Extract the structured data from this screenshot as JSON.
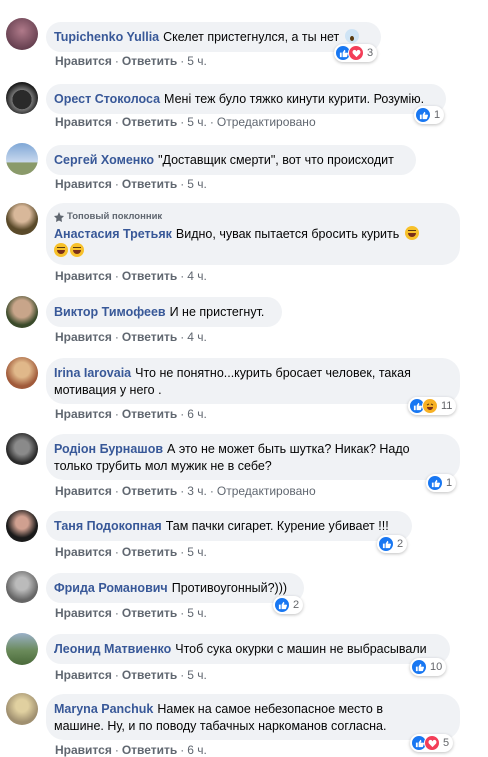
{
  "colors": {
    "author": "#385898",
    "bubble": "#f0f2f5",
    "like": "#1877f2",
    "love": "#f33e58",
    "haha": "#f7b125"
  },
  "labels": {
    "like": "Нравится",
    "reply": "Ответить",
    "edited": "Отредактировано",
    "top_fan": "Топовый поклонник"
  },
  "comments": [
    {
      "author": "Tupichenko Yullia",
      "text": "Скелет пристегнулся, а ты нет",
      "time": "5 ч.",
      "reactions": [
        "like",
        "love"
      ],
      "reaction_count": "3",
      "emoji": "scream"
    },
    {
      "author": "Орест Стоколоса",
      "text": "Мені теж було тяжко кинути курити. Розумію.",
      "time": "5 ч.",
      "edited": true,
      "reactions": [
        "like"
      ],
      "reaction_count": "1"
    },
    {
      "author": "Сергей Хоменко",
      "text": "\"Доставщик смерти\", вот что происходит",
      "time": "5 ч."
    },
    {
      "author": "Анастасия Третьяк",
      "text": "Видно, чувак пытается бросить курить",
      "time": "4 ч.",
      "top_fan": true,
      "emoji": "laugh"
    },
    {
      "author": "Виктор Тимофеев",
      "text": "И не пристегнут.",
      "time": "4 ч."
    },
    {
      "author": "Irina Iarovaia",
      "text": "Что не понятно...курить бросает человек, такая",
      "text2": "мотивация у него .",
      "time": "6 ч.",
      "reactions": [
        "like",
        "haha"
      ],
      "reaction_count": "11"
    },
    {
      "author": "Родіон Бурнашов",
      "text": "А это не может быть шутка? Никак? Надо",
      "text2": "только трубить мол мужик не в себе?",
      "time": "3 ч.",
      "edited": true,
      "reactions": [
        "like"
      ],
      "reaction_count": "1"
    },
    {
      "author": "Таня Подокопная",
      "text": "Там пачки сигарет. Курение убивает !!!",
      "time": "5 ч.",
      "reactions": [
        "like"
      ],
      "reaction_count": "2"
    },
    {
      "author": "Фрида Романович",
      "text": "Противоугонный?)))",
      "time": "5 ч.",
      "reactions": [
        "like"
      ],
      "reaction_count": "2"
    },
    {
      "author": "Леонид Матвиенко",
      "text": "Чтоб сука окурки с машин не выбрасывали",
      "time": "5 ч.",
      "reactions": [
        "like"
      ],
      "reaction_count": "10"
    },
    {
      "author": "Maryna Panchuk",
      "text": "Намек на самое небезопасное место в",
      "text2": "машине. Ну, и по поводу табачных наркоманов согласна.",
      "time": "6 ч.",
      "reactions": [
        "like",
        "love"
      ],
      "reaction_count": "5"
    }
  ]
}
